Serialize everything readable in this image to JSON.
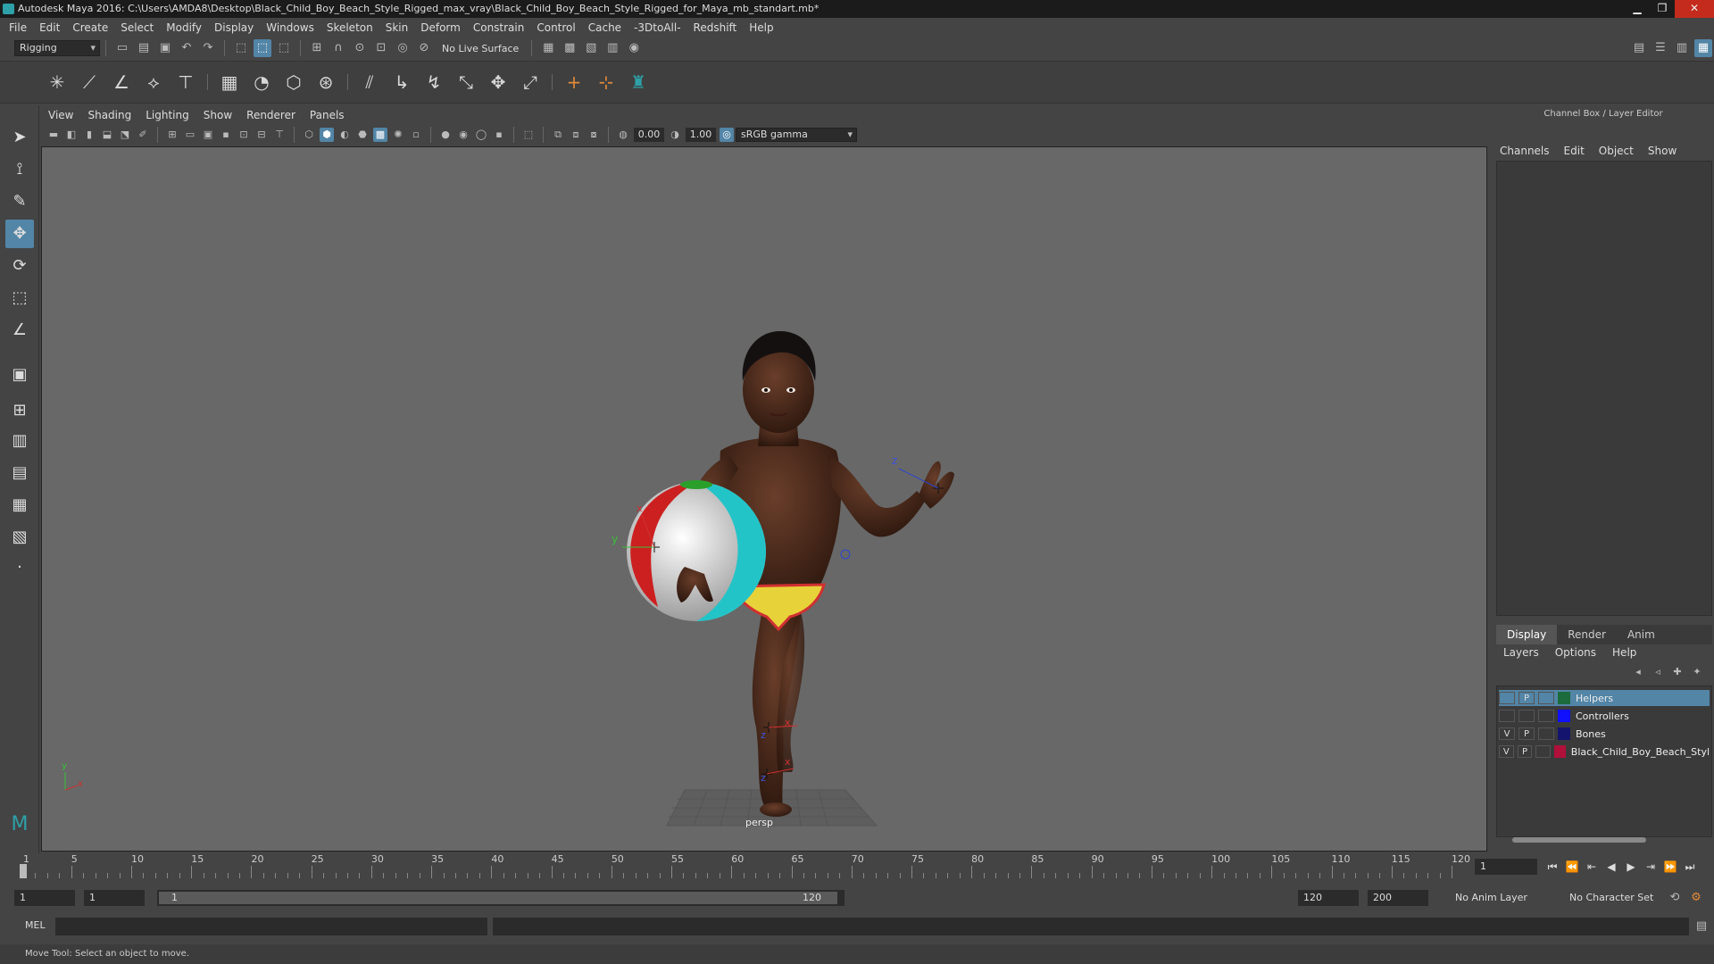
{
  "title_bar": {
    "title": "Autodesk Maya 2016: C:\\Users\\AMDA8\\Desktop\\Black_Child_Boy_Beach_Style_Rigged_max_vray\\Black_Child_Boy_Beach_Style_Rigged_for_Maya_mb_standart.mb*",
    "minimize": "▁",
    "restore": "❐",
    "close": "✕"
  },
  "menu": [
    "File",
    "Edit",
    "Create",
    "Select",
    "Modify",
    "Display",
    "Windows",
    "Skeleton",
    "Skin",
    "Deform",
    "Constrain",
    "Control",
    "Cache",
    "-3DtoAll-",
    "Redshift",
    "Help"
  ],
  "status_line": {
    "menu_set": "Rigging",
    "live_surface": "No Live Surface"
  },
  "viewport": {
    "menu": [
      "View",
      "Shading",
      "Lighting",
      "Show",
      "Renderer",
      "Panels"
    ],
    "exposure": "0.00",
    "gamma": "1.00",
    "color_space": "sRGB gamma",
    "camera_label": "persp",
    "axis_labels": {
      "z_hand": "z",
      "y_hand": "y",
      "x_hand": "x",
      "x_foot": "x",
      "z_foot": "z",
      "x_foot2": "x",
      "z_foot2": "z"
    },
    "origin_axes": {
      "y": "y",
      "x": "x"
    }
  },
  "channel_box": {
    "title": "Channel Box / Layer Editor",
    "tabs": [
      "Channels",
      "Edit",
      "Object",
      "Show"
    ]
  },
  "layer_editor": {
    "tabs": [
      "Display",
      "Render",
      "Anim"
    ],
    "menu": [
      "Layers",
      "Options",
      "Help"
    ],
    "layers": [
      {
        "name": "Helpers",
        "v": "",
        "p": "P",
        "color": "#1c6b3c",
        "selected": true
      },
      {
        "name": "Controllers",
        "v": "",
        "p": "",
        "color": "#1010ff",
        "selected": false
      },
      {
        "name": "Bones",
        "v": "V",
        "p": "P",
        "color": "#14146e",
        "selected": false
      },
      {
        "name": "Black_Child_Boy_Beach_Styl",
        "v": "V",
        "p": "P",
        "color": "#b0103a",
        "selected": false
      }
    ]
  },
  "time_slider": {
    "ticks": [
      "1",
      "5",
      "10",
      "15",
      "20",
      "25",
      "30",
      "35",
      "40",
      "45",
      "50",
      "55",
      "60",
      "65",
      "70",
      "75",
      "80",
      "85",
      "90",
      "95",
      "100",
      "105",
      "110",
      "115",
      "120"
    ],
    "current_frame": "1"
  },
  "range": {
    "start": "1",
    "playback_start": "1",
    "range_start_label": "1",
    "range_end_label": "120",
    "playback_end": "120",
    "end": "200",
    "anim_layer": "No Anim Layer",
    "character_set": "No Character Set"
  },
  "command_line": {
    "label": "MEL"
  },
  "help_line": "Move Tool: Select an object to move."
}
